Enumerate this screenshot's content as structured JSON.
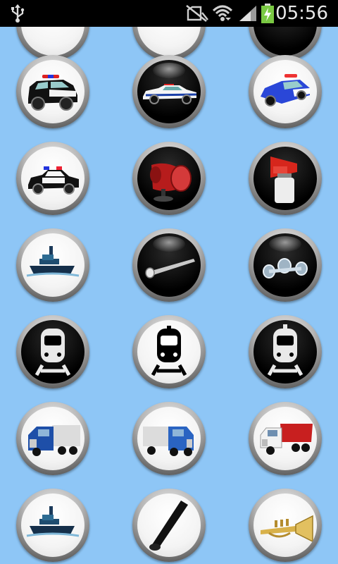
{
  "status_bar": {
    "time": "05:56",
    "icons": [
      "usb-icon",
      "no-sim-icon",
      "wifi-icon",
      "signal-icon",
      "battery-charging-icon"
    ]
  },
  "sound_buttons": [
    {
      "icon": "police-suv-icon"
    },
    {
      "icon": "police-car-icon"
    },
    {
      "icon": "police-cruiser-icon"
    },
    {
      "icon": "police-car-siren-icon"
    },
    {
      "icon": "siren-horn-icon"
    },
    {
      "icon": "air-horn-icon"
    },
    {
      "icon": "tugboat-icon"
    },
    {
      "icon": "train-horn-icon"
    },
    {
      "icon": "truck-horns-icon"
    },
    {
      "icon": "train-white-icon"
    },
    {
      "icon": "train-black-icon"
    },
    {
      "icon": "train-white-2-icon"
    },
    {
      "icon": "semi-truck-icon"
    },
    {
      "icon": "semi-truck-2-icon"
    },
    {
      "icon": "dump-truck-icon"
    },
    {
      "icon": "tugboat-2-icon"
    },
    {
      "icon": "vuvuzela-icon"
    },
    {
      "icon": "trumpet-icon"
    }
  ]
}
